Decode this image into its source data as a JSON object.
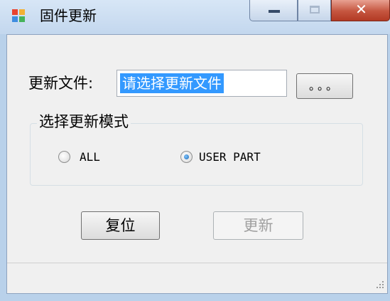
{
  "window": {
    "title": "固件更新"
  },
  "form": {
    "file_label": "更新文件:",
    "file_input_value": "请选择更新文件",
    "browse_label": "。。。",
    "mode_group_title": "选择更新模式",
    "modes": [
      {
        "label": "ALL",
        "selected": false
      },
      {
        "label": "USER PART",
        "selected": true
      }
    ],
    "reset_label": "复位",
    "update_label": "更新",
    "update_enabled": false
  },
  "colors": {
    "selection": "#3399ff",
    "client_bg": "#f0f0f0",
    "close_button": "#c5553f"
  },
  "icons": {
    "app": "app-window-icon",
    "minimize": "minimize-icon",
    "maximize": "maximize-icon",
    "close": "close-icon",
    "resize_grip": "resize-grip-icon"
  }
}
